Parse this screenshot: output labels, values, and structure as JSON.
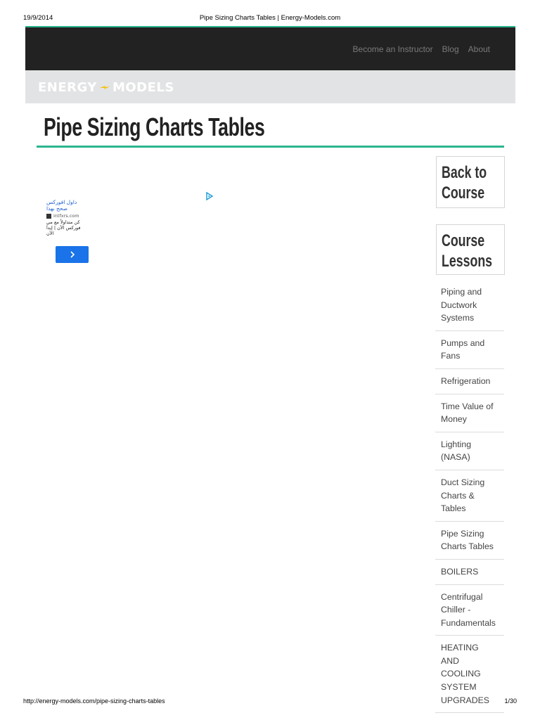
{
  "print_header": {
    "date": "19/9/2014",
    "title": "Pipe Sizing Charts Tables | Energy-Models.com"
  },
  "nav": {
    "links": [
      "Become an Instructor",
      "Blog",
      "About"
    ]
  },
  "logo": {
    "left": "ENERGY",
    "right": "MODELS"
  },
  "page": {
    "title": "Pipe Sizing Charts Tables"
  },
  "ad": {
    "title": "داول افوركس صحح بهذا",
    "domain": "intfxrs.com",
    "text": "كن متداولاً مع مي فوركس الآن | إيدأ الآن",
    "icon": "chevron-right-icon"
  },
  "sidebar": {
    "back_label": "Back to Course",
    "lessons_label": "Course Lessons",
    "lessons": [
      "Piping and Ductwork Systems",
      "Pumps and Fans",
      "Refrigeration",
      "Time Value of Money",
      "Lighting (NASA)",
      "Duct Sizing Charts & Tables",
      "Pipe Sizing Charts Tables",
      "BOILERS",
      "Centrifugal Chiller - Fundamentals",
      "HEATING AND COOLING SYSTEM UPGRADES"
    ]
  },
  "print_footer": {
    "url": "http://energy-models.com/pipe-sizing-charts-tables",
    "page": "1/30"
  },
  "colors": {
    "accent": "#2bb58f",
    "nav_bg": "#222222",
    "logo_band": "#e2e3e4",
    "ad_button": "#1a73e8"
  }
}
